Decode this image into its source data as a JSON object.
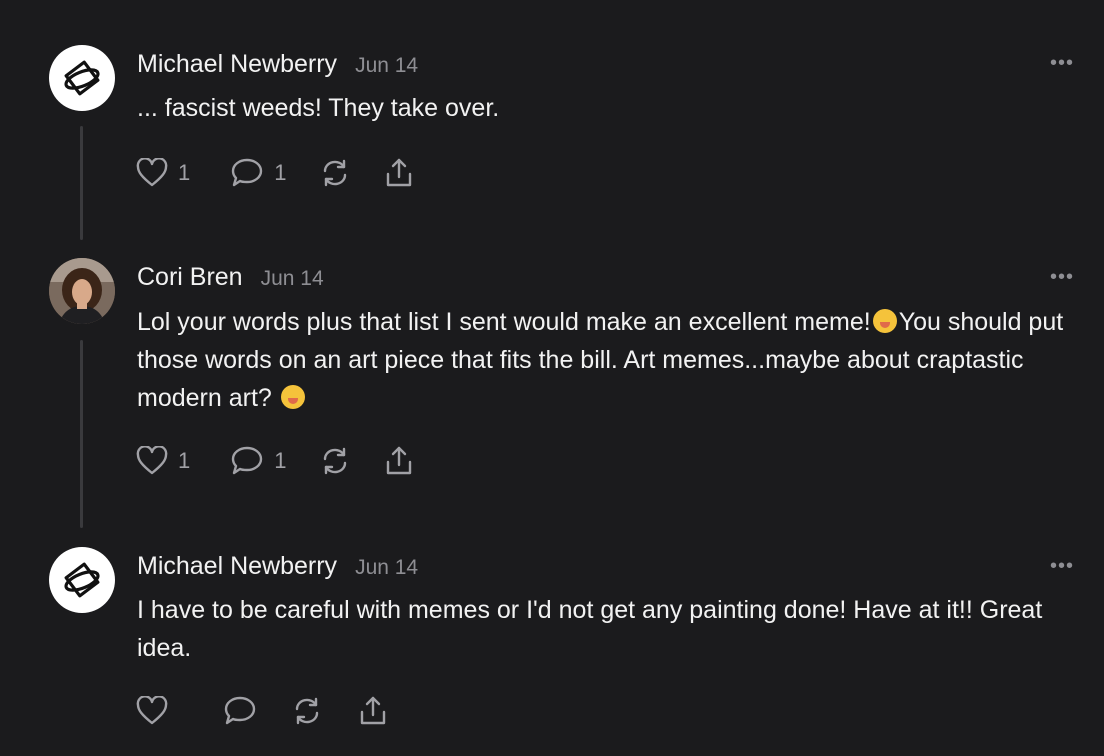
{
  "comments": [
    {
      "author": "Michael Newberry",
      "date": "Jun 14",
      "body": "... fascist weeds! They take over.",
      "likes": "1",
      "replies": "1",
      "avatar_icon": "logo-icon"
    },
    {
      "author": "Cori Bren",
      "date": "Jun 14",
      "body_part1": "Lol your words plus that list I sent would make an excellent meme!",
      "emoji1": "zany-face-emoji",
      "body_part2": "You should put those words on an art piece that fits the bill. Art memes...maybe about craptastic modern art? ",
      "emoji2": "face-with-hand-over-mouth-emoji",
      "likes": "1",
      "replies": "1",
      "avatar_icon": "profile-photo"
    },
    {
      "author": "Michael Newberry",
      "date": "Jun 14",
      "body": "I have to be careful with memes or I'd not get any painting done! Have at it!! Great idea.",
      "avatar_icon": "logo-icon"
    }
  ],
  "more_label": "•••",
  "colors": {
    "background": "#1b1b1d",
    "text": "#f2f2f2",
    "muted": "#8e8e93",
    "thread_line": "#3a3a3d"
  }
}
